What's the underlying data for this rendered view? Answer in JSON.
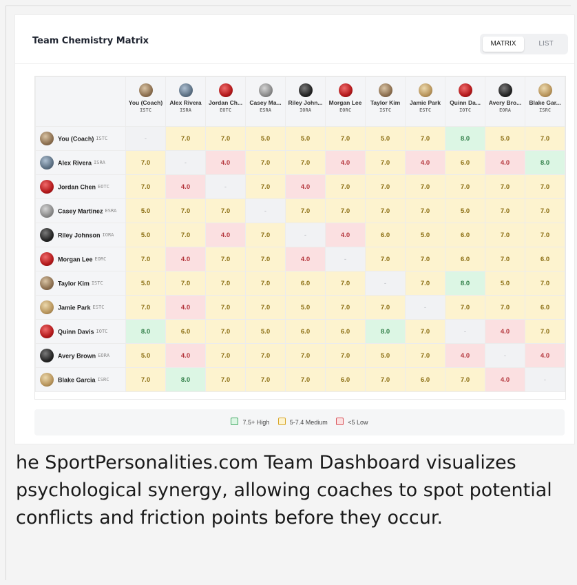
{
  "dashboard": {
    "title": "Team Chemistry Matrix",
    "view_toggle": {
      "matrix_label": "MATRIX",
      "list_label": "LIST",
      "selected": "MATRIX"
    }
  },
  "players": [
    {
      "name": "You (Coach)",
      "short": "You (Coach)",
      "code": "ISTC",
      "avatar": "brown"
    },
    {
      "name": "Alex Rivera",
      "short": "Alex Rivera",
      "code": "ISRA",
      "avatar": "steel"
    },
    {
      "name": "Jordan Chen",
      "short": "Jordan Ch...",
      "code": "EOTC",
      "avatar": "red"
    },
    {
      "name": "Casey Martinez",
      "short": "Casey Ma...",
      "code": "ESRA",
      "avatar": "gray"
    },
    {
      "name": "Riley Johnson",
      "short": "Riley John...",
      "code": "IORA",
      "avatar": "black"
    },
    {
      "name": "Morgan Lee",
      "short": "Morgan Lee",
      "code": "EORC",
      "avatar": "red"
    },
    {
      "name": "Taylor Kim",
      "short": "Taylor Kim",
      "code": "ISTC",
      "avatar": "brown"
    },
    {
      "name": "Jamie Park",
      "short": "Jamie Park",
      "code": "ESTC",
      "avatar": "gold"
    },
    {
      "name": "Quinn Davis",
      "short": "Quinn Da...",
      "code": "IOTC",
      "avatar": "red"
    },
    {
      "name": "Avery Brown",
      "short": "Avery Bro...",
      "code": "EORA",
      "avatar": "black"
    },
    {
      "name": "Blake Garcia",
      "short": "Blake Gar...",
      "code": "ISRC",
      "avatar": "gold"
    }
  ],
  "matrix": [
    [
      "-",
      "7.0",
      "7.0",
      "5.0",
      "5.0",
      "7.0",
      "5.0",
      "7.0",
      "8.0",
      "5.0",
      "7.0"
    ],
    [
      "7.0",
      "-",
      "4.0",
      "7.0",
      "7.0",
      "4.0",
      "7.0",
      "4.0",
      "6.0",
      "4.0",
      "8.0"
    ],
    [
      "7.0",
      "4.0",
      "-",
      "7.0",
      "4.0",
      "7.0",
      "7.0",
      "7.0",
      "7.0",
      "7.0",
      "7.0"
    ],
    [
      "5.0",
      "7.0",
      "7.0",
      "-",
      "7.0",
      "7.0",
      "7.0",
      "7.0",
      "5.0",
      "7.0",
      "7.0"
    ],
    [
      "5.0",
      "7.0",
      "4.0",
      "7.0",
      "-",
      "4.0",
      "6.0",
      "5.0",
      "6.0",
      "7.0",
      "7.0"
    ],
    [
      "7.0",
      "4.0",
      "7.0",
      "7.0",
      "4.0",
      "-",
      "7.0",
      "7.0",
      "6.0",
      "7.0",
      "6.0"
    ],
    [
      "5.0",
      "7.0",
      "7.0",
      "7.0",
      "6.0",
      "7.0",
      "-",
      "7.0",
      "8.0",
      "5.0",
      "7.0"
    ],
    [
      "7.0",
      "4.0",
      "7.0",
      "7.0",
      "5.0",
      "7.0",
      "7.0",
      "-",
      "7.0",
      "7.0",
      "6.0"
    ],
    [
      "8.0",
      "6.0",
      "7.0",
      "5.0",
      "6.0",
      "6.0",
      "8.0",
      "7.0",
      "-",
      "4.0",
      "7.0"
    ],
    [
      "5.0",
      "4.0",
      "7.0",
      "7.0",
      "7.0",
      "7.0",
      "5.0",
      "7.0",
      "4.0",
      "-",
      "4.0"
    ],
    [
      "7.0",
      "8.0",
      "7.0",
      "7.0",
      "7.0",
      "6.0",
      "7.0",
      "6.0",
      "7.0",
      "4.0",
      "-"
    ]
  ],
  "legend": {
    "high": "7.5+ High",
    "medium": "5-7.4 Medium",
    "low": "<5 Low"
  },
  "colors": {
    "high_bg": "#dcf6e4",
    "high_text": "#2f7d46",
    "medium_bg": "#fdf3cf",
    "medium_text": "#8a6d12",
    "low_bg": "#fbe0e1",
    "low_text": "#b4373d",
    "self_bg": "#f1f2f4"
  },
  "caption": "he SportPersonalities.com Team Dashboard visualizes psychological synergy, allowing coaches to spot potential conflicts and friction points before they occur."
}
